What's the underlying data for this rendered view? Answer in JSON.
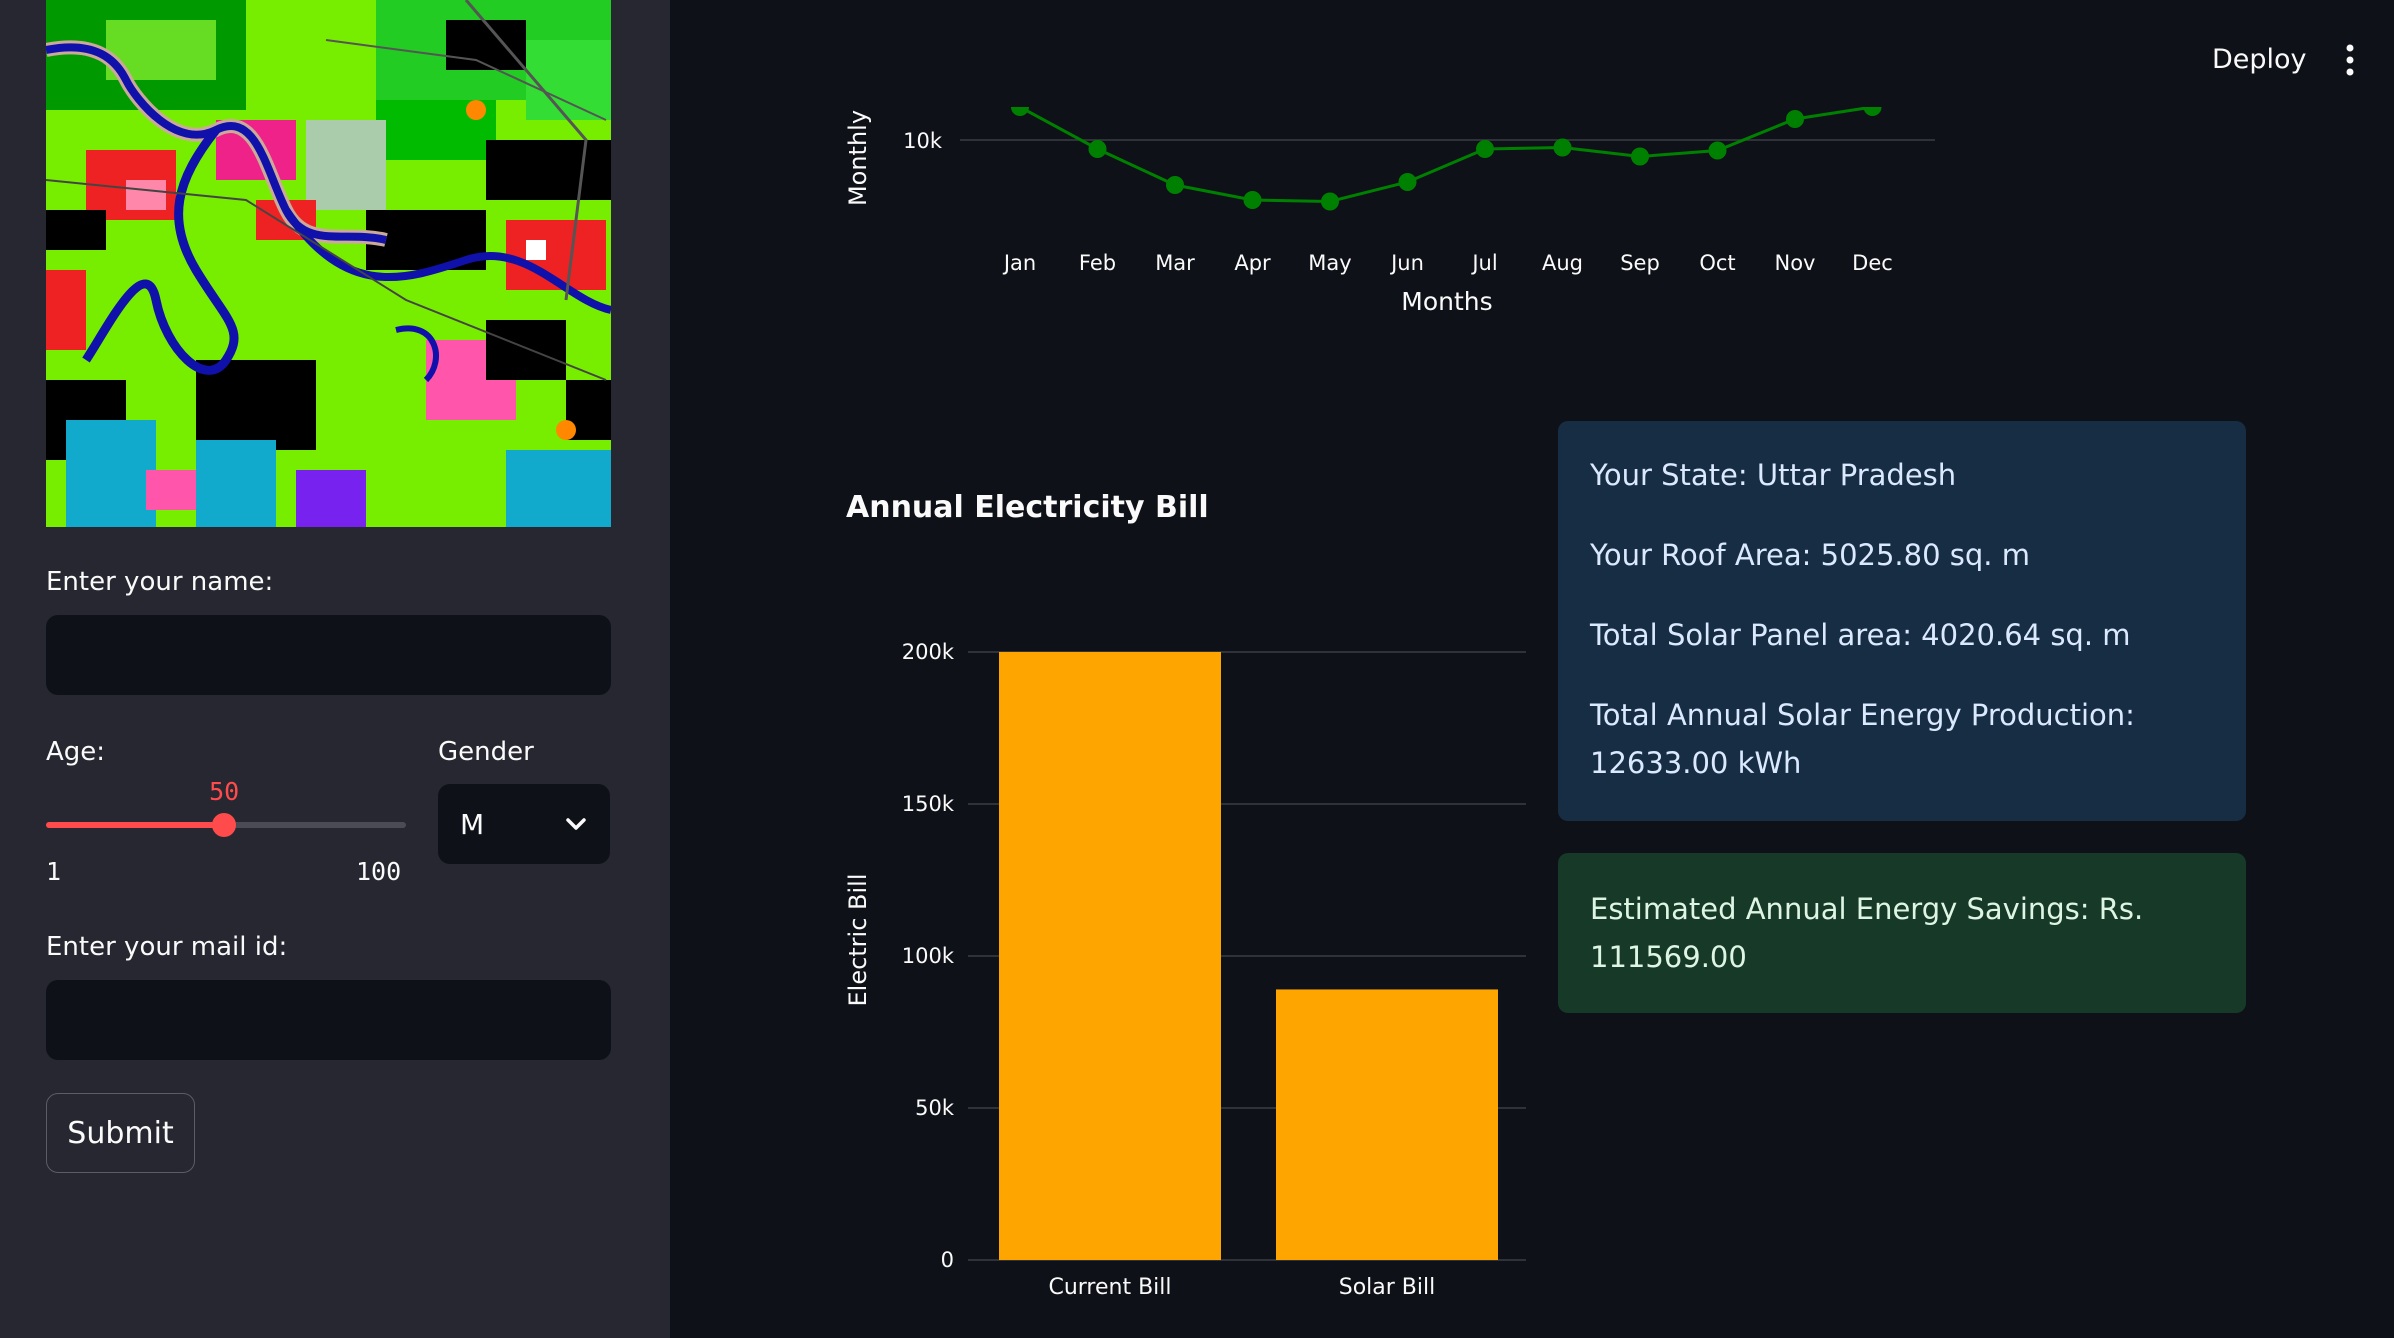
{
  "sidebar": {
    "name_label": "Enter your name:",
    "name_value": "",
    "age_label": "Age:",
    "age_value": 50,
    "age_value_text": "50",
    "age_min": "1",
    "age_max": "100",
    "gender_label": "Gender",
    "gender_selected": "M",
    "mail_label": "Enter your mail id:",
    "mail_value": "",
    "submit_label": "Submit"
  },
  "header": {
    "deploy_label": "Deploy",
    "menu_icon": "more-vertical-icon"
  },
  "line_chart": {
    "xlabel": "Months",
    "ylabel": "Monthly",
    "ytick_label": "10k",
    "color": "#008000"
  },
  "bar_chart_title": "Annual Electricity Bill",
  "info": {
    "state": "Your State: Uttar Pradesh",
    "roof_area": "Your Roof Area: 5025.80 sq. m",
    "panel_area": "Total Solar Panel area: 4020.64 sq. m",
    "production": "Total Annual Solar Energy Production: 12633.00 kWh"
  },
  "savings": "Estimated Annual Energy Savings: Rs. 111569.00",
  "colors": {
    "accent": "#ff4b4b",
    "bar": "#ffa500",
    "line": "#008000",
    "info_bg": "#172d43",
    "success_bg": "#173928"
  },
  "chart_data": [
    {
      "type": "line",
      "x": [
        "Jan",
        "Feb",
        "Mar",
        "Apr",
        "May",
        "Jun",
        "Jul",
        "Aug",
        "Sep",
        "Oct",
        "Nov",
        "Dec"
      ],
      "series": [
        {
          "values": [
            11100,
            9700,
            8500,
            8000,
            7950,
            8600,
            9700,
            9750,
            9450,
            9650,
            10700,
            11100
          ]
        }
      ],
      "xlabel": "Months",
      "ylabel": "Monthly",
      "yticks": [
        10000
      ],
      "ytick_labels": [
        "10k"
      ],
      "ylim": [
        7000,
        11000
      ],
      "grid": true
    },
    {
      "type": "bar",
      "title": "Annual Electricity Bill",
      "categories": [
        "Current Bill",
        "Solar Bill"
      ],
      "values": [
        200000,
        89000
      ],
      "ylabel": "Electric Bill",
      "yticks": [
        0,
        50000,
        100000,
        150000,
        200000
      ],
      "ytick_labels": [
        "0",
        "50k",
        "100k",
        "150k",
        "200k"
      ],
      "ylim": [
        0,
        200000
      ],
      "grid": true
    }
  ]
}
